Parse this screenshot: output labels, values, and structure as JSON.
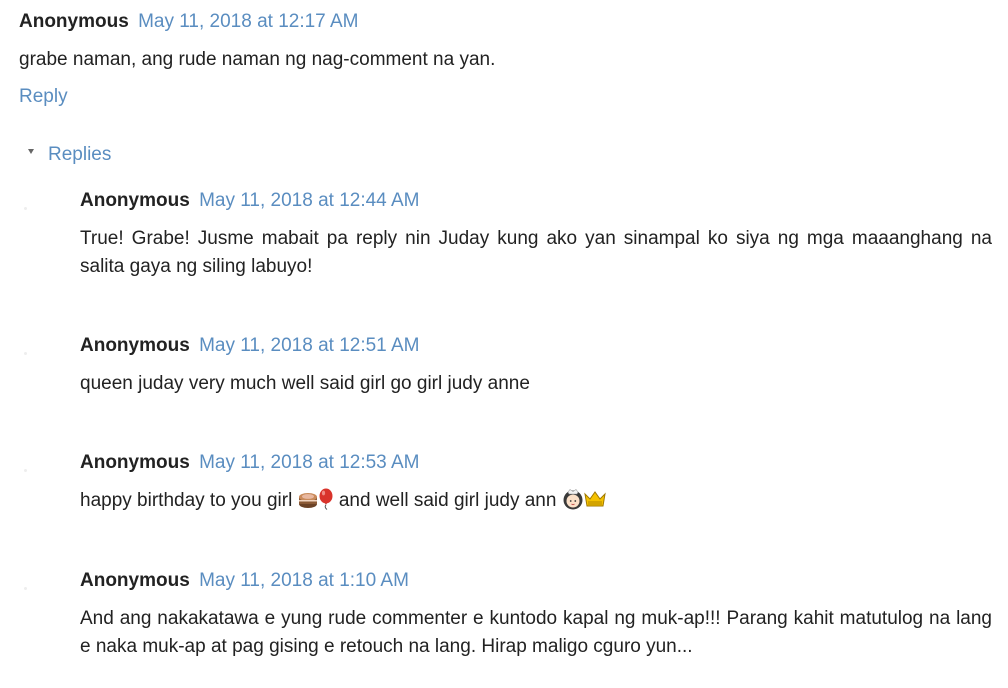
{
  "main_comment": {
    "author": "Anonymous",
    "timestamp": "May 11, 2018 at 12:17 AM",
    "text": "grabe naman, ang rude naman ng nag-comment na yan.",
    "reply_label": "Reply"
  },
  "replies_toggle": {
    "label": "Replies"
  },
  "replies": [
    {
      "author": "Anonymous",
      "timestamp": "May 11, 2018 at 12:44 AM",
      "text": "True! Grabe! Jusme mabait pa reply nin Juday kung ako yan sinampal ko siya ng mga maaanghang na salita gaya ng siling labuyo!"
    },
    {
      "author": "Anonymous",
      "timestamp": "May 11, 2018 at 12:51 AM",
      "text": "queen juday very much well said girl go girl judy anne"
    },
    {
      "author": "Anonymous",
      "timestamp": "May 11, 2018 at 12:53 AM",
      "text_part1": "happy birthday to you girl",
      "emojis_1": [
        "cake-emoji",
        "balloon-emoji"
      ],
      "text_part2": "and well said girl judy ann",
      "emojis_2": [
        "princess-emoji",
        "crown-emoji"
      ]
    },
    {
      "author": "Anonymous",
      "timestamp": "May 11, 2018 at 1:10 AM",
      "text": "And ang nakakatawa e yung rude commenter e kuntodo kapal ng muk-ap!!! Parang kahit matutulog na lang e naka muk-ap at pag gising e retouch na lang. Hirap maligo cguro yun..."
    }
  ],
  "colors": {
    "link": "#5a8dc0",
    "text": "#222222"
  }
}
